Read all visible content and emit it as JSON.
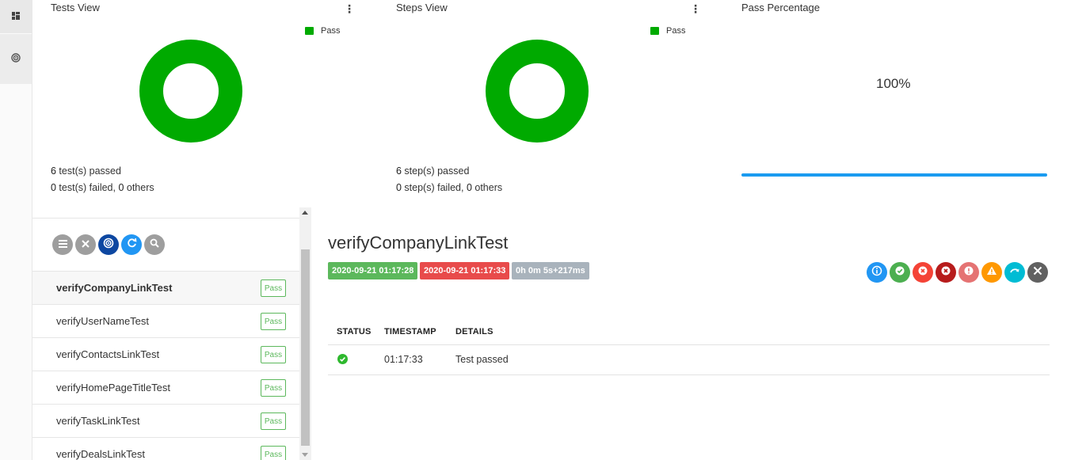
{
  "rail": {
    "items": [
      {
        "icon": "dashboard-icon"
      },
      {
        "icon": "radar-icon"
      }
    ]
  },
  "tests_view": {
    "title": "Tests View",
    "legend": "Pass",
    "passed_count": "6",
    "passed_text": " test(s) passed",
    "failed_count": "0",
    "failed_text": " test(s) failed, ",
    "others_count": "0",
    "others_text": " others",
    "pass_color": "#00aa00"
  },
  "steps_view": {
    "title": "Steps View",
    "legend": "Pass",
    "passed_count": "6",
    "passed_text": " step(s) passed",
    "failed_count": "0",
    "failed_text": " step(s) failed, ",
    "others_count": "0",
    "others_text": " others",
    "pass_color": "#00aa00"
  },
  "pass_percentage": {
    "title": "Pass Percentage",
    "value_text": "100%",
    "value": 1.0,
    "bar_color": "#1a9bf0"
  },
  "toolbar": {
    "buttons": [
      {
        "icon": "list-icon",
        "color": "#9e9e9e"
      },
      {
        "icon": "close-icon",
        "color": "#9e9e9e"
      },
      {
        "icon": "radar-icon",
        "color": "#0d47a1"
      },
      {
        "icon": "refresh-icon",
        "color": "#2196f3"
      },
      {
        "icon": "search-icon",
        "color": "#9e9e9e"
      }
    ]
  },
  "tests": [
    {
      "name": "verifyCompanyLinkTest",
      "status": "Pass"
    },
    {
      "name": "verifyUserNameTest",
      "status": "Pass"
    },
    {
      "name": "verifyContactsLinkTest",
      "status": "Pass"
    },
    {
      "name": "verifyHomePageTitleTest",
      "status": "Pass"
    },
    {
      "name": "verifyTaskLinkTest",
      "status": "Pass"
    },
    {
      "name": "verifyDealsLinkTest",
      "status": "Pass"
    }
  ],
  "detail": {
    "title": "verifyCompanyLinkTest",
    "start_time": "2020-09-21 01:17:28",
    "end_time": "2020-09-21 01:17:33",
    "duration": "0h 0m 5s+217ms",
    "start_color": "#5cb85c",
    "end_color": "#e84b4b",
    "duration_color": "#a9b3bc",
    "filters": [
      {
        "icon": "info-icon",
        "color": "#2196f3"
      },
      {
        "icon": "check-icon",
        "color": "#4caf50"
      },
      {
        "icon": "fail-icon",
        "color": "#f44336"
      },
      {
        "icon": "fatal-icon",
        "color": "#b71c1c"
      },
      {
        "icon": "error-icon",
        "color": "#e57373"
      },
      {
        "icon": "warning-icon",
        "color": "#ff9800"
      },
      {
        "icon": "skip-icon",
        "color": "#00bcd4"
      },
      {
        "icon": "clear-filter-icon",
        "color": "#616161"
      }
    ],
    "table": {
      "headers": [
        "STATUS",
        "TIMESTAMP",
        "DETAILS"
      ],
      "rows": [
        {
          "status_icon": "pass-check-icon",
          "timestamp": "01:17:33",
          "details": "Test passed"
        }
      ]
    }
  }
}
